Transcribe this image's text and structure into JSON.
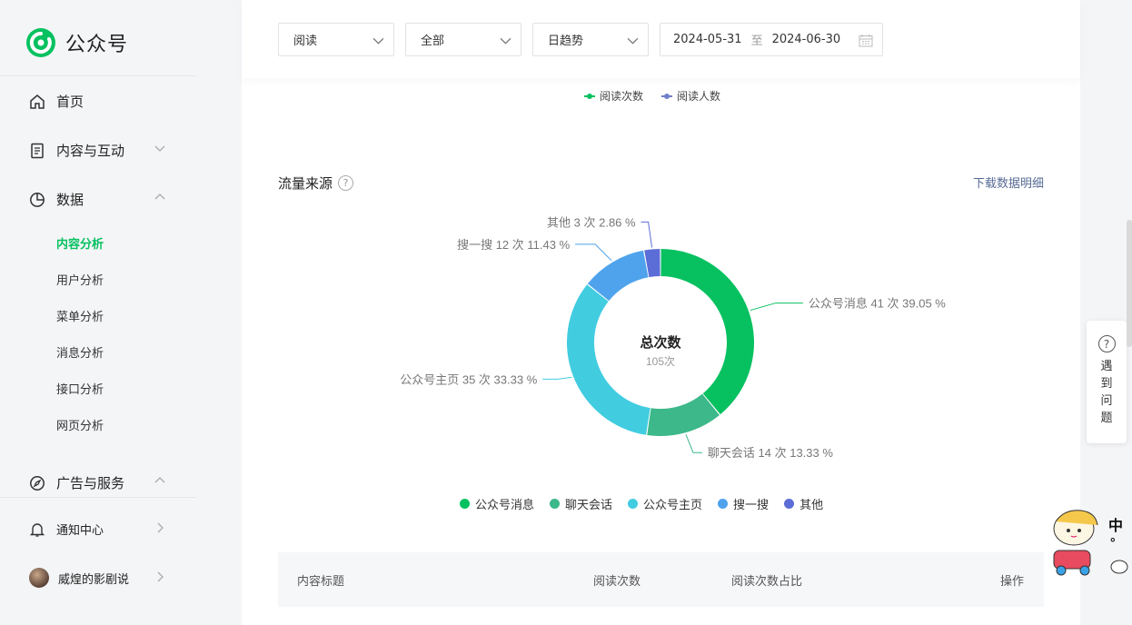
{
  "app": {
    "title": "公众号"
  },
  "sidebar": {
    "items": [
      {
        "label": "首页"
      },
      {
        "label": "内容与互动"
      },
      {
        "label": "数据"
      }
    ],
    "sub_items": [
      {
        "label": "内容分析"
      },
      {
        "label": "用户分析"
      },
      {
        "label": "菜单分析"
      },
      {
        "label": "消息分析"
      },
      {
        "label": "接口分析"
      },
      {
        "label": "网页分析"
      }
    ],
    "ads": {
      "label": "广告与服务"
    },
    "notifications": {
      "label": "通知中心"
    },
    "account": {
      "label": "威煌的影剧说"
    }
  },
  "filters": {
    "metric": "阅读",
    "scope": "全部",
    "trend": "日趋势",
    "date_from": "2024-05-31",
    "date_sep": "至",
    "date_to": "2024-06-30"
  },
  "trend_legend": [
    {
      "label": "阅读次数",
      "color": "#07c160"
    },
    {
      "label": "阅读人数",
      "color": "#6f7fc9"
    }
  ],
  "traffic": {
    "title": "流量来源",
    "help": "?",
    "download": "下载数据明细"
  },
  "chart_data": {
    "type": "pie",
    "center_title": "总次数",
    "center_value": "105次",
    "series": [
      {
        "name": "公众号消息",
        "value": 41,
        "label": "公众号消息 41 次 39.05 %",
        "color": "#07c160"
      },
      {
        "name": "聊天会话",
        "value": 14,
        "label": "聊天会话 14 次 13.33 %",
        "color": "#3cb88a"
      },
      {
        "name": "公众号主页",
        "value": 35,
        "label": "公众号主页 35 次 33.33 %",
        "color": "#41cce0"
      },
      {
        "name": "搜一搜",
        "value": 12,
        "label": "搜一搜 12 次 11.43 %",
        "color": "#4fa3ec"
      },
      {
        "name": "其他",
        "value": 3,
        "label": "其他 3 次 2.86 %",
        "color": "#5b6dd6"
      }
    ]
  },
  "table": {
    "headers": [
      "内容标题",
      "阅读次数",
      "阅读次数占比",
      "操作"
    ]
  },
  "help_float": {
    "icon": "?",
    "text": "遇到问题"
  },
  "mascot": {
    "text1": "中",
    "text2": "°"
  }
}
